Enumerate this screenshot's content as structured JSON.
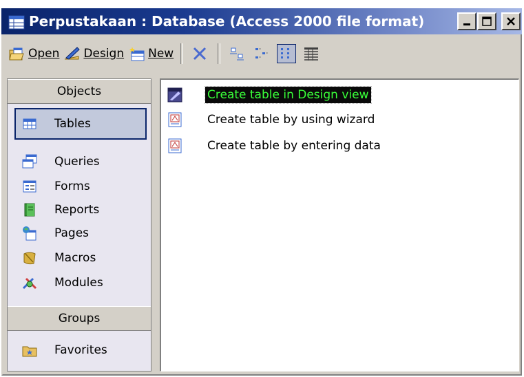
{
  "window": {
    "title": "Perpustakaan : Database (Access 2000 file format)",
    "controls": [
      "minimize",
      "maximize",
      "close"
    ]
  },
  "toolbar": {
    "open_label": "Open",
    "design_label": "Design",
    "new_label": "New",
    "icons": [
      "open-icon",
      "design-icon",
      "new-icon",
      "delete-icon",
      "large-icons-icon",
      "small-icons-icon",
      "list-icon",
      "details-icon"
    ]
  },
  "objects_bar": {
    "objects_header": "Objects",
    "items": [
      {
        "label": "Tables",
        "icon": "table-icon",
        "selected": true
      },
      {
        "label": "Queries",
        "icon": "query-icon"
      },
      {
        "label": "Forms",
        "icon": "form-icon"
      },
      {
        "label": "Reports",
        "icon": "report-icon"
      },
      {
        "label": "Pages",
        "icon": "page-icon"
      },
      {
        "label": "Macros",
        "icon": "macro-icon"
      },
      {
        "label": "Modules",
        "icon": "module-icon"
      }
    ],
    "groups_header": "Groups",
    "groups": [
      {
        "label": "Favorites",
        "icon": "favorites-folder-icon"
      }
    ]
  },
  "list": {
    "items": [
      {
        "label": "Create table in Design view",
        "icon": "design-view-icon",
        "selected": true
      },
      {
        "label": "Create table by using wizard",
        "icon": "wizard-icon"
      },
      {
        "label": "Create table by entering data",
        "icon": "datasheet-icon"
      }
    ]
  },
  "colors": {
    "title_start": "#0a246a",
    "title_end": "#a6b8e6",
    "selection_bg": "#0a0a0a",
    "selection_text": "#39ff39",
    "face": "#d4d0c8"
  }
}
